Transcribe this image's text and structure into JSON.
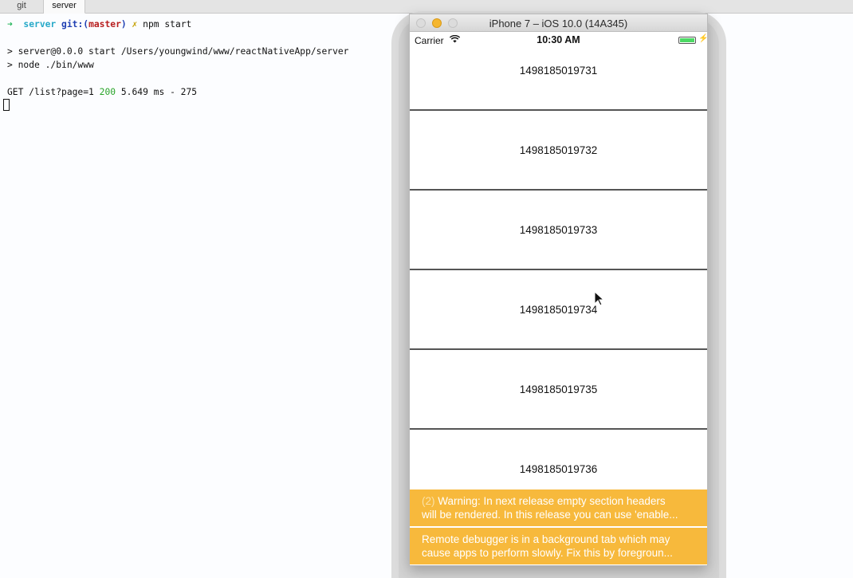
{
  "terminal": {
    "tabs": [
      "git",
      "server"
    ],
    "prompt": {
      "arrow": "➜",
      "dir": "server",
      "git_label": "git:",
      "branch_open": "(",
      "branch": "master",
      "branch_close": ")",
      "dirty": "✗",
      "command": "npm start"
    },
    "lines": [
      "> server@0.0.0 start /Users/youngwind/www/reactNativeApp/server",
      "> node ./bin/www"
    ],
    "request": {
      "method_path": "GET /list?page=1",
      "status": "200",
      "rest": "5.649 ms - 275"
    }
  },
  "simulator": {
    "title": "iPhone 7 – iOS 10.0 (14A345)",
    "status": {
      "carrier": "Carrier",
      "time": "10:30 AM"
    },
    "rows": [
      "1498185019731",
      "1498185019732",
      "1498185019733",
      "1498185019734",
      "1498185019735",
      "1498185019736"
    ],
    "warnings": [
      {
        "count": "(2)",
        "line1": "Warning: In next release empty section headers",
        "line2": "will be rendered. In this release you can use 'enable..."
      },
      {
        "count": "",
        "line1": "Remote debugger is in a background tab which may",
        "line2": "cause apps to perform slowly. Fix this by foregroun..."
      }
    ],
    "colors": {
      "warning_bg": "#f7b93c",
      "battery": "#4cd964"
    }
  }
}
